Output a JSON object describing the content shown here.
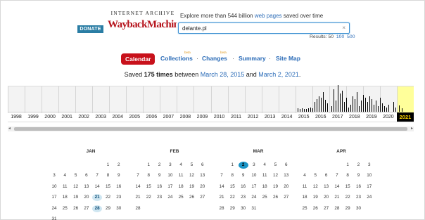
{
  "header": {
    "donate_label": "DONATE",
    "logo_top": "INTERNET ARCHIVE",
    "logo_main": "WaybackMachine",
    "tagline_prefix": "Explore more than 544 billion ",
    "tagline_link": "web pages",
    "tagline_suffix": " saved over time",
    "search_value": "delante.pl",
    "clear_icon": "×",
    "results_label": "Results:",
    "results_options": [
      "50",
      "100",
      "500"
    ]
  },
  "tabs": {
    "calendar": "Calendar",
    "collections": "Collections",
    "changes": "Changes",
    "summary": "Summary",
    "sitemap": "Site Map",
    "beta": "beta",
    "separator": "·"
  },
  "saved": {
    "prefix": "Saved ",
    "count": "175 times",
    "between": " between ",
    "start": "March 28, 2015",
    "and": " and ",
    "end": "March 2, 2021",
    "period": "."
  },
  "timeline": {
    "years": [
      "1998",
      "1999",
      "2000",
      "2001",
      "2002",
      "2003",
      "2004",
      "2005",
      "2006",
      "2007",
      "2008",
      "2009",
      "2010",
      "2011",
      "2012",
      "2013",
      "2014",
      "2015",
      "2016",
      "2017",
      "2018",
      "2019",
      "2020",
      "2021"
    ],
    "current_year": "2021",
    "highlight_color": "#ffff9a",
    "scroll_left_icon": "◂",
    "scroll_right_icon": "▸"
  },
  "calendar": {
    "months": [
      {
        "name": "JAN",
        "first_weekday": 5,
        "days": 31,
        "highlights": [
          21,
          28
        ]
      },
      {
        "name": "FEB",
        "first_weekday": 1,
        "days": 28,
        "highlights": []
      },
      {
        "name": "MAR",
        "first_weekday": 1,
        "days": 31,
        "highlights": [
          2
        ]
      },
      {
        "name": "APR",
        "first_weekday": 4,
        "days": 30,
        "highlights": []
      }
    ]
  },
  "colors": {
    "accent_red": "#c8111b",
    "link_blue": "#2a6bb7",
    "donate_bg": "#2a7da4"
  }
}
